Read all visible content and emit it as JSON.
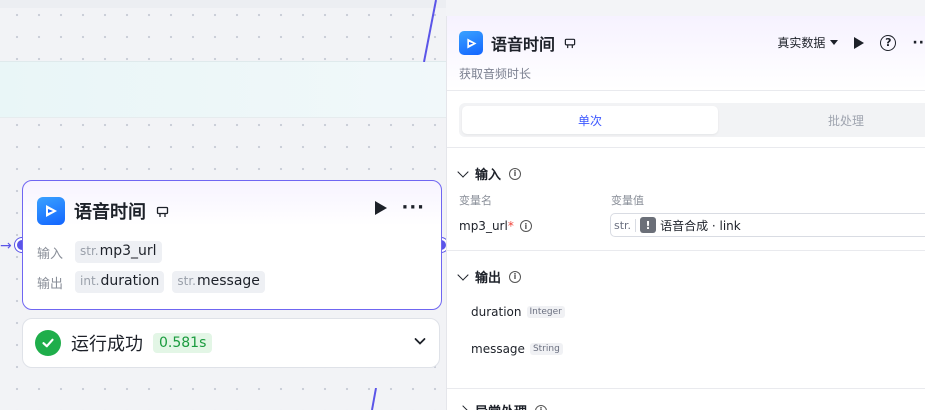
{
  "node": {
    "title": "语音时间",
    "input_label": "输入",
    "output_label": "输出",
    "inputs": [
      {
        "type": "str.",
        "name": "mp3_url"
      }
    ],
    "outputs": [
      {
        "type": "int.",
        "name": "duration"
      },
      {
        "type": "str.",
        "name": "message"
      }
    ],
    "icons": {
      "plugin": "plugin-badge-icon",
      "run": "play-icon",
      "more": "more-icon"
    }
  },
  "status": {
    "text": "运行成功",
    "time": "0.581s",
    "color": "#1fae4b"
  },
  "panel": {
    "title": "语音时间",
    "subtitle": "获取音频时长",
    "data_select": "真实数据",
    "tabs": [
      {
        "label": "单次",
        "active": true
      },
      {
        "label": "批处理",
        "active": false
      }
    ],
    "input_section": {
      "title": "输入",
      "col_name": "变量名",
      "col_value": "变量值",
      "variables": [
        {
          "name": "mp3_url",
          "required": "*",
          "type": "str.",
          "reference": "语音合成 · link"
        }
      ]
    },
    "output_section": {
      "title": "输出",
      "items": [
        {
          "name": "duration",
          "type": "Integer"
        },
        {
          "name": "message",
          "type": "String"
        }
      ]
    },
    "exception_section": {
      "title": "异常处理"
    }
  },
  "colors": {
    "accent": "#5b55e8",
    "tab_active": "#3c57ff",
    "success": "#1fae4b"
  }
}
